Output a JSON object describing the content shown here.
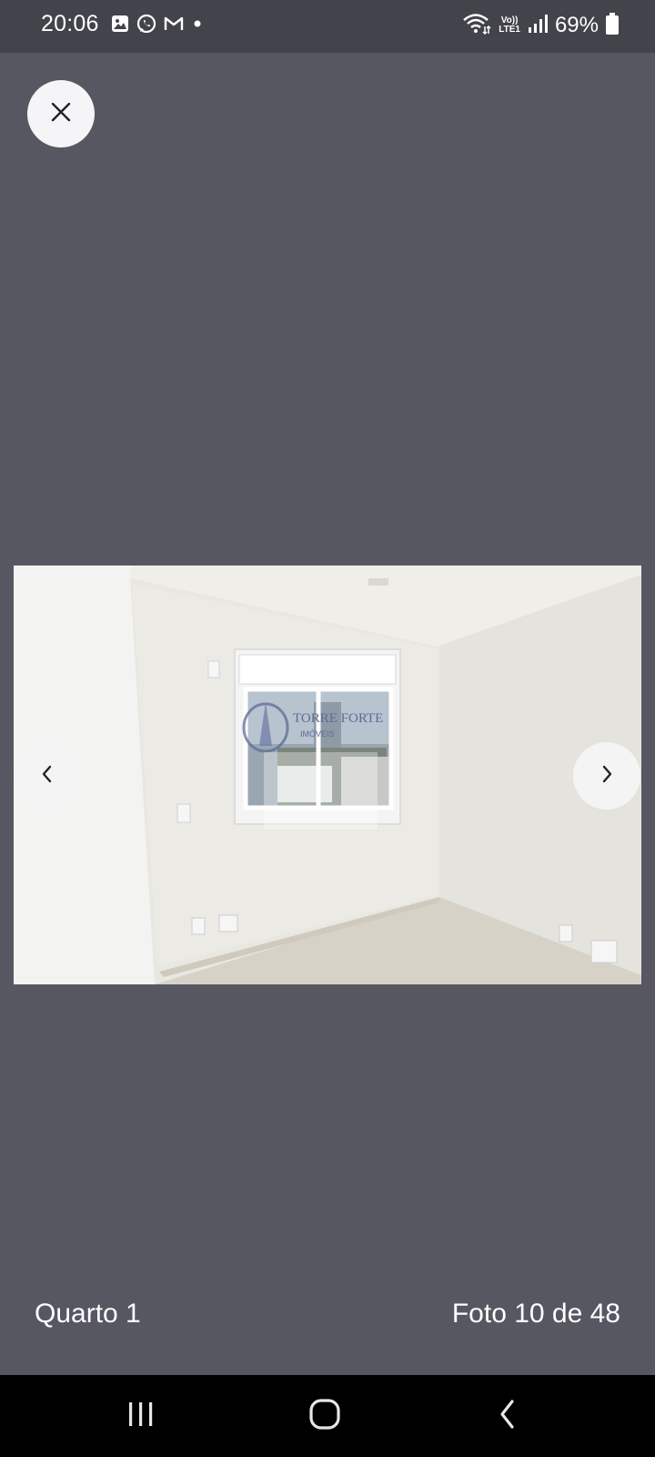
{
  "status_bar": {
    "time": "20:06",
    "battery_percent": "69%",
    "volte_top": "Vo))",
    "volte_bottom": "LTE1",
    "notification_icons": [
      "gallery-icon",
      "whatsapp-icon",
      "gmail-icon",
      "dot-icon"
    ],
    "system_icons": [
      "wifi-icon",
      "volte-icon",
      "signal-icon",
      "battery-icon"
    ]
  },
  "viewer": {
    "close_icon": "close-icon",
    "prev_icon": "chevron-left-icon",
    "next_icon": "chevron-right-icon",
    "photo_watermark_line1": "TORRE FORTE",
    "photo_watermark_line2": "IMÓVEIS",
    "caption_title": "Quarto 1",
    "photo_counter": "Foto 10 de 48",
    "current_photo": 10,
    "total_photos": 48
  },
  "nav_bar": {
    "recents_icon": "recents-icon",
    "home_icon": "home-icon",
    "back_icon": "back-icon"
  },
  "colors": {
    "background": "#565761",
    "status_bar": "#42434b",
    "button_bg": "#f5f5f7",
    "text": "#ffffff",
    "nav_bar": "#000000"
  }
}
